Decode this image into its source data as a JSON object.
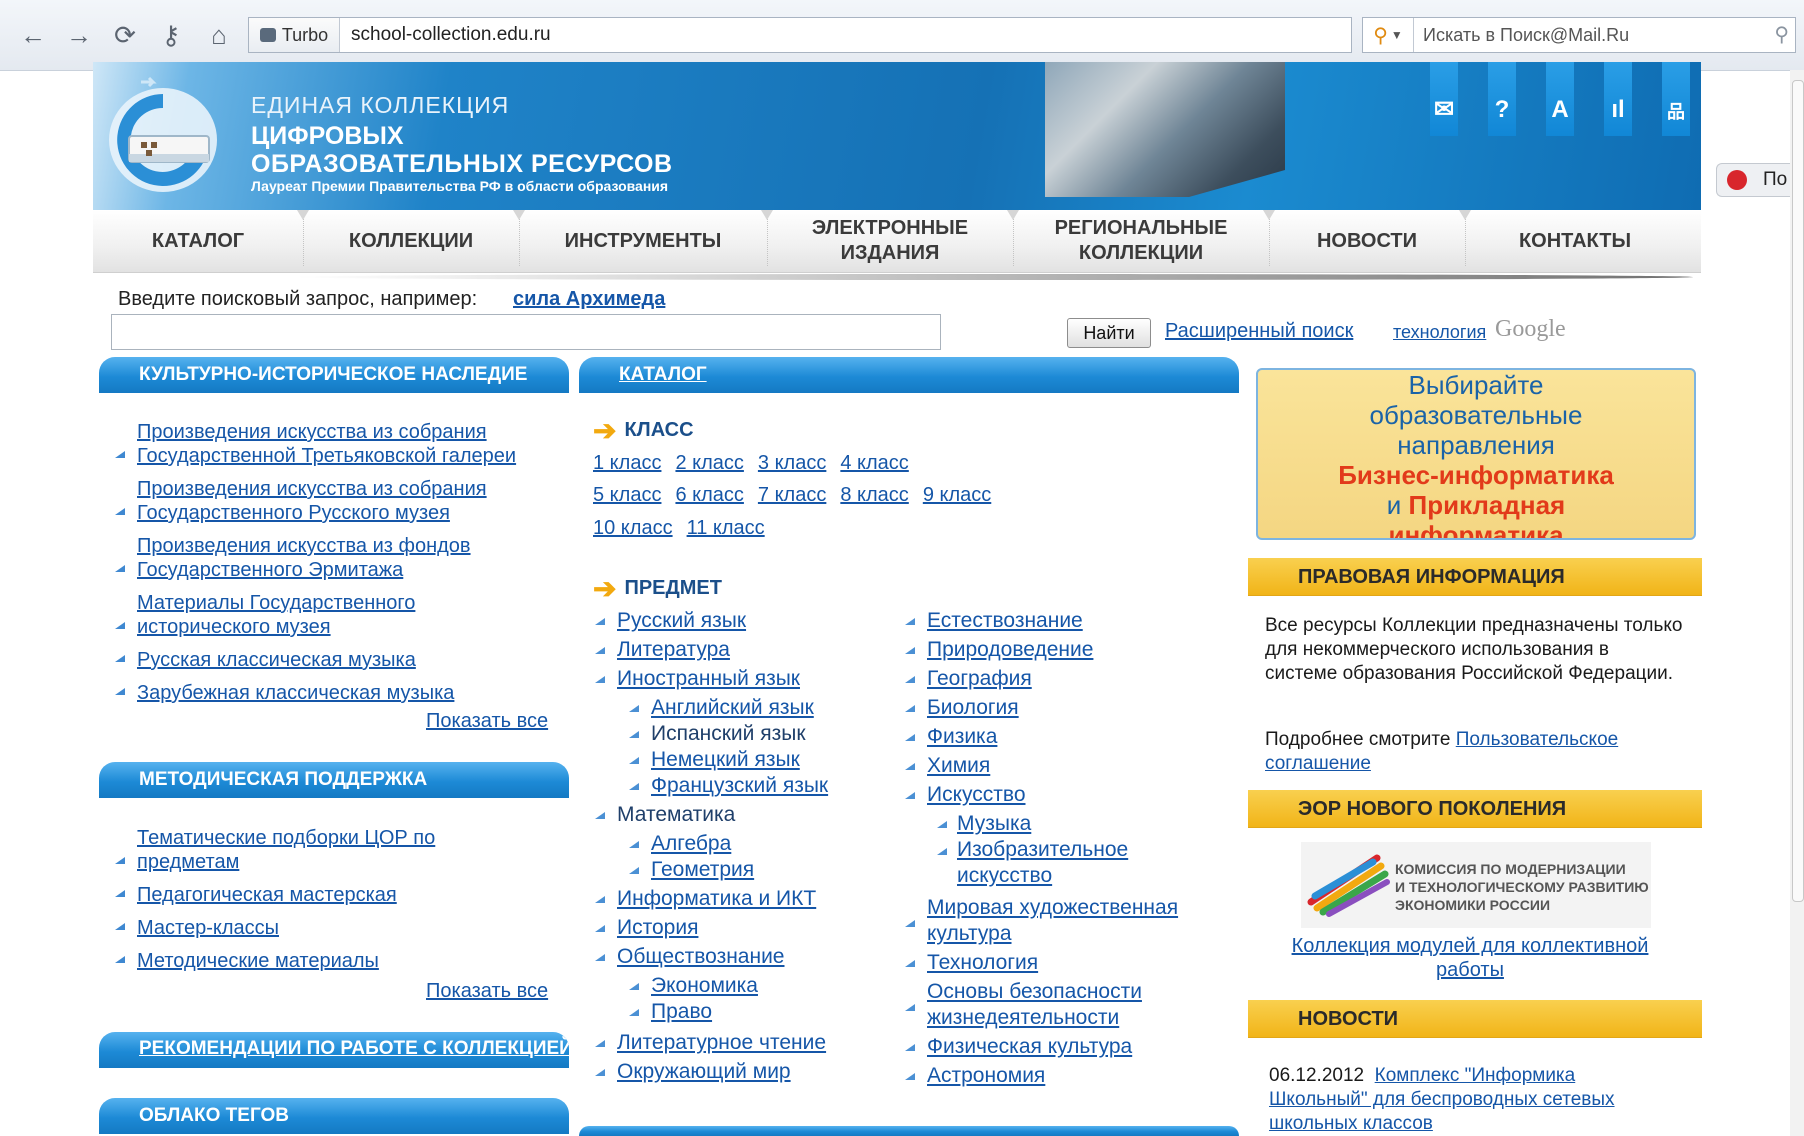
{
  "browser": {
    "turbo_label": "Turbo",
    "url": "school-collection.edu.ru",
    "search_placeholder": "Искать в Поиск@Mail.Ru",
    "side_button_label": "По"
  },
  "header": {
    "logo_line1": "ЕДИНАЯ КОЛЛЕКЦИЯ",
    "logo_line2": "ЦИФРОВЫХ",
    "logo_line3": "ОБРАЗОВАТЕЛЬНЫХ РЕСУРСОВ",
    "logo_award": "Лауреат Премии Правительства РФ в области образования",
    "icons": [
      "mail-icon",
      "help-icon",
      "font-icon",
      "stats-icon",
      "sitemap-icon"
    ],
    "icon_glyphs": [
      "✉",
      "?",
      "A",
      "ıl",
      "品"
    ]
  },
  "menu": [
    "КАТАЛОГ",
    "КОЛЛЕКЦИИ",
    "ИНСТРУМЕНТЫ",
    "ЭЛЕКТРОННЫЕ ИЗДАНИЯ",
    "РЕГИОНАЛЬНЫЕ КОЛЛЕКЦИИ",
    "НОВОСТИ",
    "КОНТАКТЫ"
  ],
  "search": {
    "label": "Введите поисковый запрос, например:",
    "example": "сила Архимеда",
    "button": "Найти",
    "advanced": "Расширенный поиск",
    "tech": "технология",
    "google": "Google"
  },
  "left": {
    "heritage_title": "КУЛЬТУРНО-ИСТОРИЧЕСКОЕ НАСЛЕДИЕ",
    "heritage_items": [
      "Произведения искусства из собрания Государственной Третьяковской галереи",
      "Произведения искусства из собрания Государственного Русского музея",
      "Произведения искусства из фондов Государственного Эрмитажа",
      "Материалы Государственного исторического музея",
      "Русская классическая музыка",
      "Зарубежная классическая музыка"
    ],
    "show_all": "Показать все",
    "method_title": "МЕТОДИЧЕСКАЯ ПОДДЕРЖКА",
    "method_items": [
      "Тематические подборки ЦОР по предметам",
      "Педагогическая мастерская",
      "Мастер-классы",
      "Методические материалы"
    ],
    "recommend_title": "РЕКОМЕНДАЦИИ ПО РАБОТЕ С КОЛЛЕКЦИЕЙ",
    "tags_title": "ОБЛАКО ТЕГОВ"
  },
  "catalog": {
    "title": "КАТАЛОГ",
    "class_heading": "КЛАСС",
    "classes": [
      "1 класс",
      "2 класс",
      "3 класс",
      "4 класс",
      "5 класс",
      "6 класс",
      "7 класс",
      "8 класс",
      "9 класс",
      "10 класс",
      "11 класс"
    ],
    "subject_heading": "ПРЕДМЕТ",
    "subjects_left": [
      "Русский язык",
      "Литература",
      "Иностранный язык",
      "Английский язык",
      "Испанский язык",
      "Немецкий язык",
      "Французский язык",
      "Математика",
      "Алгебра",
      "Геометрия",
      "Информатика и ИКТ",
      "История",
      "Обществознание",
      "Экономика",
      "Право",
      "Литературное чтение",
      "Окружающий мир"
    ],
    "subjects_right": [
      "Естествознание",
      "Природоведение",
      "География",
      "Биология",
      "Физика",
      "Химия",
      "Искусство",
      "Музыка",
      "Изобразительное искусство",
      "Мировая художественная культура",
      "Технология",
      "Основы безопасности жизнедеятельности",
      "Физическая культура",
      "Астрономия"
    ]
  },
  "right": {
    "promo_l1": "Выбирайте",
    "promo_l2": "образовательные",
    "promo_l3": "направления",
    "promo_l4": "Бизнес-информатика",
    "promo_l5a": "и",
    "promo_l5b": "Прикладная",
    "promo_l6": "информатика",
    "legal_title": "ПРАВОВАЯ ИНФОРМАЦИЯ",
    "legal_text": "Все ресурсы Коллекции предназначены только для некоммерческого использования в системе образования Российской Федерации.",
    "legal_more": "Подробнее смотрите",
    "legal_link": "Пользовательское соглашение",
    "eor_title": "ЭОР НОВОГО ПОКОЛЕНИЯ",
    "commission_l1": "КОМИССИЯ ПО МОДЕРНИЗАЦИИ",
    "commission_l2": "И ТЕХНОЛОГИЧЕСКОМУ РАЗВИТИЮ",
    "commission_l3": "ЭКОНОМИКИ РОССИИ",
    "modules_link": "Коллекция модулей для коллективной работы",
    "news_title": "НОВОСТИ",
    "news_date": "06.12.2012",
    "news_link": "Комплекс \"Информика Школьный\" для беспроводных сетевых школьных классов"
  }
}
